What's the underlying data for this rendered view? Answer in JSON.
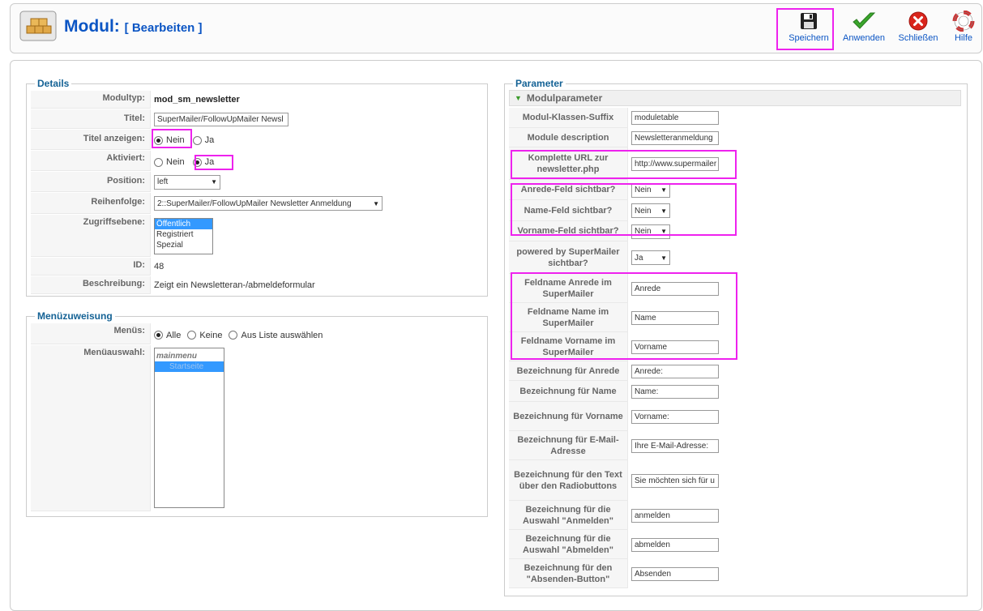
{
  "header": {
    "title": "Modul:",
    "subtitle": "[ Bearbeiten ]"
  },
  "toolbar": {
    "save": "Speichern",
    "apply": "Anwenden",
    "close": "Schließen",
    "help": "Hilfe"
  },
  "details": {
    "legend": "Details",
    "moduletype_label": "Modultyp:",
    "moduletype_value": "mod_sm_newsletter",
    "title_label": "Titel:",
    "title_value": "SuperMailer/FollowUpMailer Newsl",
    "showtitle_label": "Titel anzeigen:",
    "no": "Nein",
    "yes": "Ja",
    "enabled_label": "Aktiviert:",
    "position_label": "Position:",
    "position_value": "left",
    "order_label": "Reihenfolge:",
    "order_value": "2::SuperMailer/FollowUpMailer Newsletter Anmeldung",
    "access_label": "Zugriffsebene:",
    "access_options": [
      "Öffentlich",
      "Registriert",
      "Spezial"
    ],
    "id_label": "ID:",
    "id_value": "48",
    "desc_label": "Beschreibung:",
    "desc_value": "Zeigt ein Newsletteran-/abmeldeformular"
  },
  "menu": {
    "legend": "Menüzuweisung",
    "menus_label": "Menüs:",
    "all": "Alle",
    "none": "Keine",
    "fromlist": "Aus Liste auswählen",
    "selection_label": "Menüauswahl:",
    "menu_group": "mainmenu",
    "menu_item": "Startseite"
  },
  "params": {
    "legend": "Parameter",
    "section": "Modulparameter",
    "rows": [
      {
        "label": "Modul-Klassen-Suffix",
        "value": "moduletable"
      },
      {
        "label": "Module description",
        "value": "Newsletteranmeldung"
      },
      {
        "label": "Komplette URL zur newsletter.php",
        "value": "http://www.supermailer"
      },
      {
        "label": "Anrede-Feld sichtbar?",
        "value": "Nein"
      },
      {
        "label": "Name-Feld sichtbar?",
        "value": "Nein"
      },
      {
        "label": "Vorname-Feld sichtbar?",
        "value": "Nein"
      },
      {
        "label": "powered by SuperMailer sichtbar?",
        "value": "Ja"
      },
      {
        "label": "Feldname Anrede im SuperMailer",
        "value": "Anrede"
      },
      {
        "label": "Feldname Name im SuperMailer",
        "value": "Name"
      },
      {
        "label": "Feldname Vorname im SuperMailer",
        "value": "Vorname"
      },
      {
        "label": "Bezeichnung für Anrede",
        "value": "Anrede:"
      },
      {
        "label": "Bezeichnung für Name",
        "value": "Name:"
      },
      {
        "label": "Bezeichnung für Vorname",
        "value": "Vorname:"
      },
      {
        "label": "Bezeichnung für E-Mail-Adresse",
        "value": "Ihre E-Mail-Adresse:"
      },
      {
        "label": "Bezeichnung für den Text über den Radiobuttons",
        "value": "Sie möchten sich für u"
      },
      {
        "label": "Bezeichnung für die Auswahl \"Anmelden\"",
        "value": "anmelden"
      },
      {
        "label": "Bezeichnung für die Auswahl \"Abmelden\"",
        "value": "abmelden"
      },
      {
        "label": "Bezeichnung für den \"Absenden-Button\"",
        "value": "Absenden"
      }
    ]
  },
  "colors": {
    "accent": "#0B55C4",
    "legend": "#146295",
    "highlight": "#ee22ee"
  }
}
